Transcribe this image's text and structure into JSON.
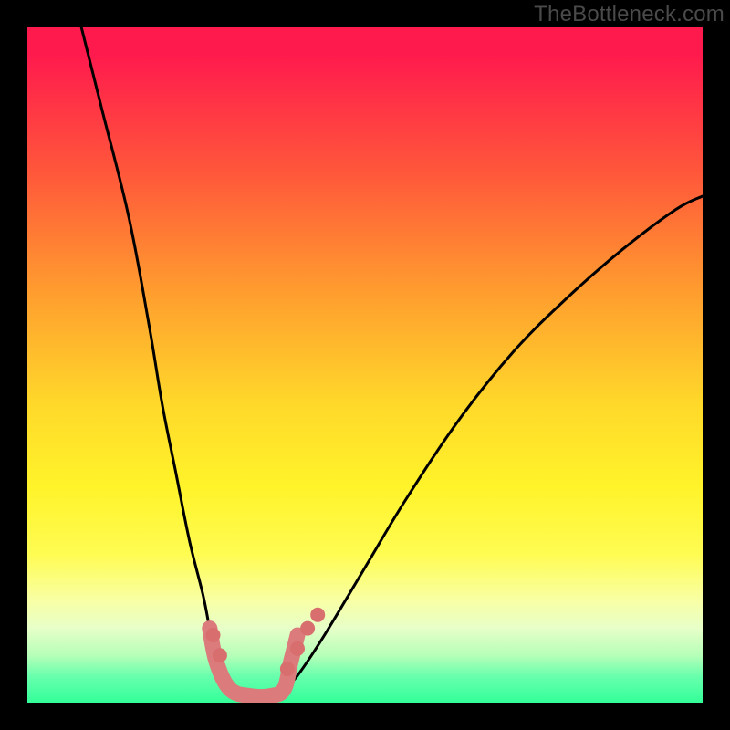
{
  "watermark": "TheBottleneck.com",
  "chart_data": {
    "type": "line",
    "title": "",
    "xlabel": "",
    "ylabel": "",
    "xlim": [
      0,
      100
    ],
    "ylim": [
      0,
      100
    ],
    "legend": false,
    "grid": false,
    "background_gradient": {
      "top_color": "#ff1a4d",
      "mid_color": "#fff32a",
      "bottom_color": "#33ff99"
    },
    "series": [
      {
        "name": "left-curve",
        "stroke": "#000000",
        "x": [
          8,
          11,
          15,
          18,
          20,
          22,
          24,
          26,
          27,
          28,
          29,
          30
        ],
        "y": [
          100,
          88,
          72,
          56,
          44,
          34,
          24,
          16,
          11,
          7,
          4,
          2
        ]
      },
      {
        "name": "right-curve",
        "stroke": "#000000",
        "x": [
          38,
          40,
          44,
          50,
          56,
          64,
          72,
          80,
          88,
          96,
          100
        ],
        "y": [
          2,
          4,
          10,
          20,
          30,
          42,
          52,
          60,
          67,
          73,
          75
        ]
      },
      {
        "name": "floor-band",
        "stroke": "#db7b7b",
        "x": [
          27,
          28,
          30,
          33,
          36,
          38,
          39,
          40
        ],
        "y": [
          11,
          6,
          2,
          1,
          1,
          2,
          6,
          10
        ]
      }
    ],
    "floor_markers": {
      "x": [
        27.5,
        28.5,
        38.5,
        40,
        41.5,
        43
      ],
      "y": [
        10,
        7,
        5,
        8,
        11,
        13
      ],
      "color": "#d86e6e",
      "radius": 8
    }
  }
}
